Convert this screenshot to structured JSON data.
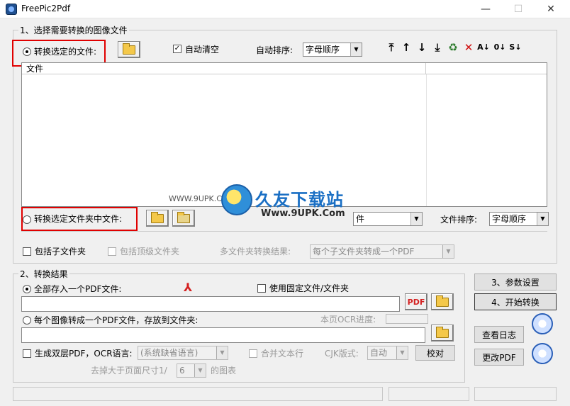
{
  "window": {
    "title": "FreePic2Pdf",
    "min": "—",
    "max": "☐",
    "close": "✕"
  },
  "group1": {
    "title": "1、选择需要转换的图像文件",
    "radio_files": "转换选定的文件:",
    "auto_clear": "自动清空",
    "auto_sort_label": "自动排序:",
    "auto_sort_value": "字母顺序",
    "toolbar_icons": [
      "move-top-icon",
      "move-up-icon",
      "move-down-icon",
      "move-bottom-icon",
      "recycle-icon",
      "delete-icon",
      "sort-az-icon",
      "sort-09-icon",
      "sort-s-icon"
    ],
    "toolbar_glyphs": [
      "⤒",
      "↑",
      "↓",
      "⤓",
      "♻",
      "✕",
      "A↓",
      "0↓",
      "S↓"
    ],
    "list_header": "文件",
    "radio_folder": "转换选定文件夹中文件:",
    "folder_combo_value": "件",
    "file_sort_label": "文件排序:",
    "file_sort_value": "字母顺序",
    "include_subfolders": "包括子文件夹",
    "include_top_folder": "包括顶级文件夹",
    "multi_folder_result_label": "多文件夹转换结果:",
    "multi_folder_result_value": "每个子文件夹转成一个PDF"
  },
  "group2": {
    "title": "2、转换结果",
    "radio_single_pdf": "全部存入一个PDF文件:",
    "use_fixed": "使用固定文件/文件夹",
    "radio_each_pdf": "每个图像转成一个PDF文件，存放到文件夹:",
    "ocr_progress_label": "本页OCR进度:",
    "double_layer": "生成双层PDF，OCR语言:",
    "ocr_language_value": "(系统缺省语言)",
    "merge_text_lines": "合并文本行",
    "cjk_label": "CJK版式:",
    "cjk_value": "自动",
    "proofread": "校对",
    "remove_larger_prefix": "去掉大于页面尺寸1/",
    "remove_larger_value": "6",
    "remove_larger_suffix": "的图表"
  },
  "buttons": {
    "settings": "3、参数设置",
    "start": "4、开始转换",
    "view_log": "查看日志",
    "change_pdf": "更改PDF"
  },
  "watermark": {
    "brand": "久友下载站",
    "url": "Www.9UPK.Com",
    "url_small": "WWW.9UPK.COM"
  },
  "colors": {
    "highlight": "#e00000",
    "watermark_blue": "#1a6fc4"
  }
}
